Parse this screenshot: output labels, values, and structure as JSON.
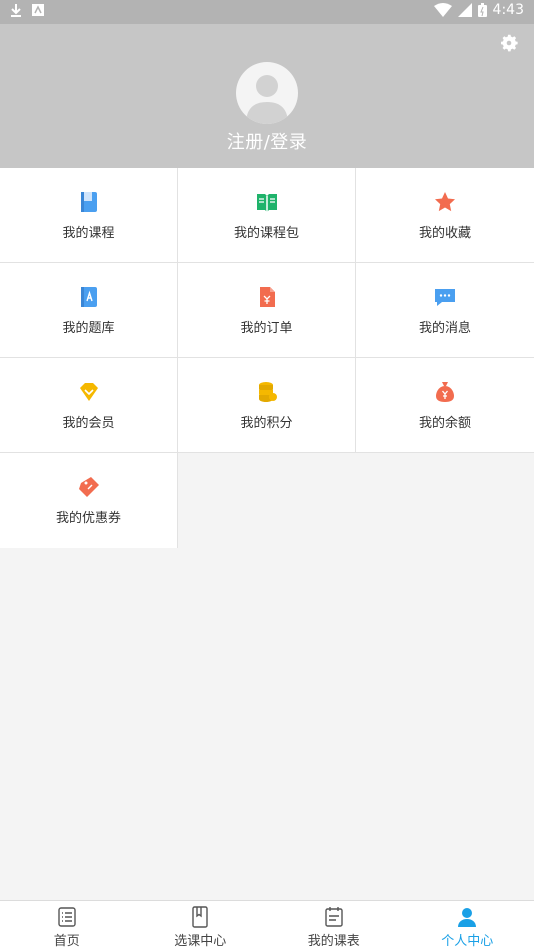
{
  "status_bar": {
    "time": "4:43",
    "notif_icons": [
      "download-icon",
      "app-icon"
    ],
    "sys_icons": [
      "wifi-icon",
      "signal-icon",
      "battery-icon"
    ]
  },
  "profile": {
    "login_label": "注册/登录",
    "settings_icon": "gear-icon",
    "avatar_icon": "avatar-icon"
  },
  "menu": [
    {
      "label": "我的课程",
      "icon": "book-icon",
      "color": "#4a9ff0"
    },
    {
      "label": "我的课程包",
      "icon": "open-book-icon",
      "color": "#1fb36b"
    },
    {
      "label": "我的收藏",
      "icon": "star-icon",
      "color": "#f26c4f"
    },
    {
      "label": "我的题库",
      "icon": "question-bank-icon",
      "color": "#4a9ff0"
    },
    {
      "label": "我的订单",
      "icon": "order-icon",
      "color": "#f26c4f"
    },
    {
      "label": "我的消息",
      "icon": "message-icon",
      "color": "#4a9ff0"
    },
    {
      "label": "我的会员",
      "icon": "vip-icon",
      "color": "#f5b800"
    },
    {
      "label": "我的积分",
      "icon": "coins-icon",
      "color": "#f5b800"
    },
    {
      "label": "我的余额",
      "icon": "money-bag-icon",
      "color": "#f26c4f"
    },
    {
      "label": "我的优惠券",
      "icon": "coupon-icon",
      "color": "#f26c4f"
    }
  ],
  "tabs": [
    {
      "label": "首页",
      "icon": "home-list-icon",
      "active": false
    },
    {
      "label": "选课中心",
      "icon": "course-book-icon",
      "active": false
    },
    {
      "label": "我的课表",
      "icon": "schedule-icon",
      "active": false
    },
    {
      "label": "个人中心",
      "icon": "person-icon",
      "active": true
    }
  ],
  "colors": {
    "header_bg": "#c6c6c6",
    "statusbar_bg": "#b3b3b3",
    "active_tab": "#1aa0e6"
  }
}
